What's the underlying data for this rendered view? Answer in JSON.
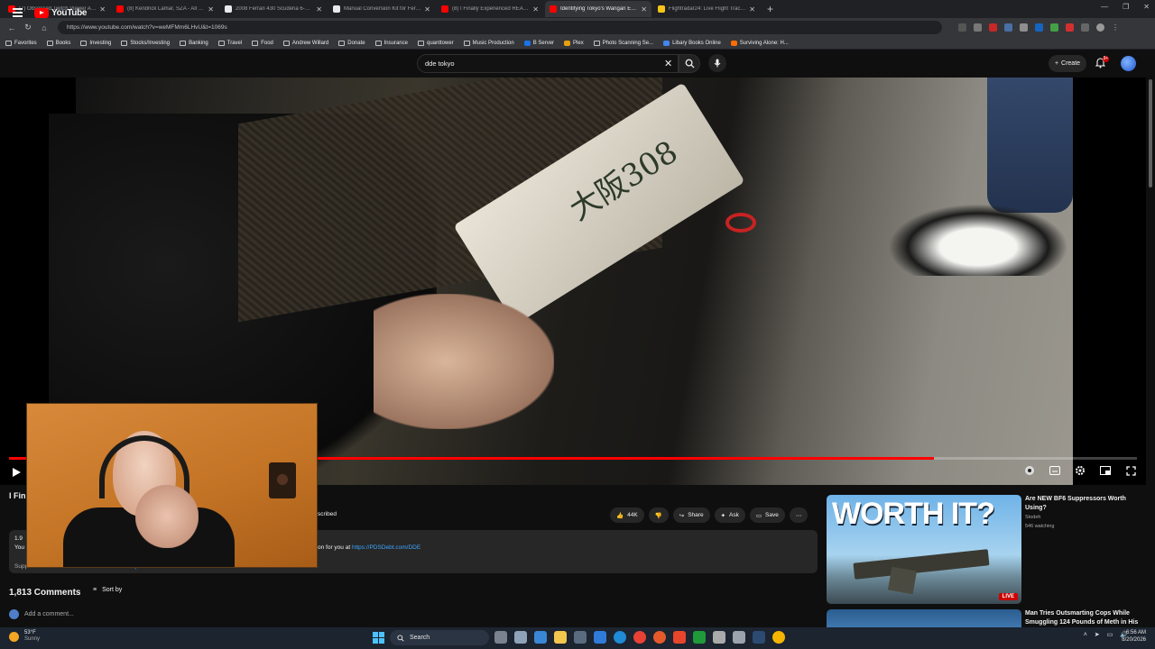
{
  "browser": {
    "tabs": [
      {
        "title": "(7) Obsessed Twitch Viewer Arre...",
        "color": "#ff0000",
        "active": false
      },
      {
        "title": "(8) Kendrick Lamar, SZA - All The...",
        "color": "#ff0000",
        "active": false
      },
      {
        "title": "2008 Ferrari 430 Scuderia 6-Speed...",
        "color": "#e8eaed",
        "active": false
      },
      {
        "title": "Manual Conversion Kit for Ferrari...",
        "color": "#e8eaed",
        "active": false
      },
      {
        "title": "(8) I Finally Experienced REAL...",
        "color": "#ff0000",
        "active": false
      },
      {
        "title": "Identifying Tokyo's Wangan Exper...",
        "color": "#ff0000",
        "active": true
      },
      {
        "title": "Flightradar24: Live Flight Tracker",
        "color": "#f5c518",
        "active": false
      }
    ],
    "url": "https://www.youtube.com/watch?v=weMFMm6LHvU&t=1069s",
    "bookmarks": [
      {
        "label": "Favorites",
        "color": ""
      },
      {
        "label": "Books",
        "color": ""
      },
      {
        "label": "Investing",
        "color": ""
      },
      {
        "label": "Stocks/Investing",
        "color": ""
      },
      {
        "label": "Banking",
        "color": ""
      },
      {
        "label": "Travel",
        "color": ""
      },
      {
        "label": "Food",
        "color": ""
      },
      {
        "label": "Andrew Willard",
        "color": ""
      },
      {
        "label": "Donate",
        "color": ""
      },
      {
        "label": "Insurance",
        "color": ""
      },
      {
        "label": "quanttower",
        "color": ""
      },
      {
        "label": "Music Production",
        "color": ""
      },
      {
        "label": "B Server",
        "color": "#1a73e8"
      },
      {
        "label": "Plex",
        "color": "#e5a00d"
      },
      {
        "label": "Photo Scanning Se...",
        "color": ""
      },
      {
        "label": "Libary Books Online",
        "color": "#4285f4"
      },
      {
        "label": "Surviving Alone: H...",
        "color": "#ff6d00"
      }
    ]
  },
  "youtube": {
    "logo_text": "YouTube",
    "search_value": "dde tokyo",
    "create_label": "Create",
    "notification_count": "9+"
  },
  "video": {
    "plate_text": "大阪308",
    "progress_fraction": 0.82,
    "title_fragment": "I Fin",
    "subscribed_label": "scribed",
    "like_count": "44K",
    "share_label": "Share",
    "ask_label": "Ask",
    "save_label": "Save"
  },
  "description": {
    "text_before_link": "on for you at ",
    "link": "https://PDSDebt.com/DDE",
    "support_text": "Support the movement. Grab Some Merch: ",
    "support_link": "https://...",
    "more_label": "...more",
    "views_fragment": "1.9",
    "you_fragment": "You"
  },
  "comments": {
    "count_label": "1,813 Comments",
    "sort_label": "Sort by",
    "add_placeholder": "Add a comment..."
  },
  "recommended": [
    {
      "thumb_text": "WORTH IT?",
      "title": "Are NEW BF6 Suppressors Worth Using?",
      "channel": "Stodeh",
      "meta": "546 watching",
      "badge": "LIVE"
    },
    {
      "title": "Man Tries Outsmarting Cops While Smuggling 124 Pounds of Meth in His"
    }
  ],
  "taskbar": {
    "temperature": "53°F",
    "condition": "Sunny",
    "search_label": "Search",
    "time": "6:56 AM",
    "date": "8/20/2026"
  },
  "colors": {
    "youtube_red": "#ff0000",
    "link_blue": "#3ea6ff",
    "bg": "#0f0f0f"
  }
}
